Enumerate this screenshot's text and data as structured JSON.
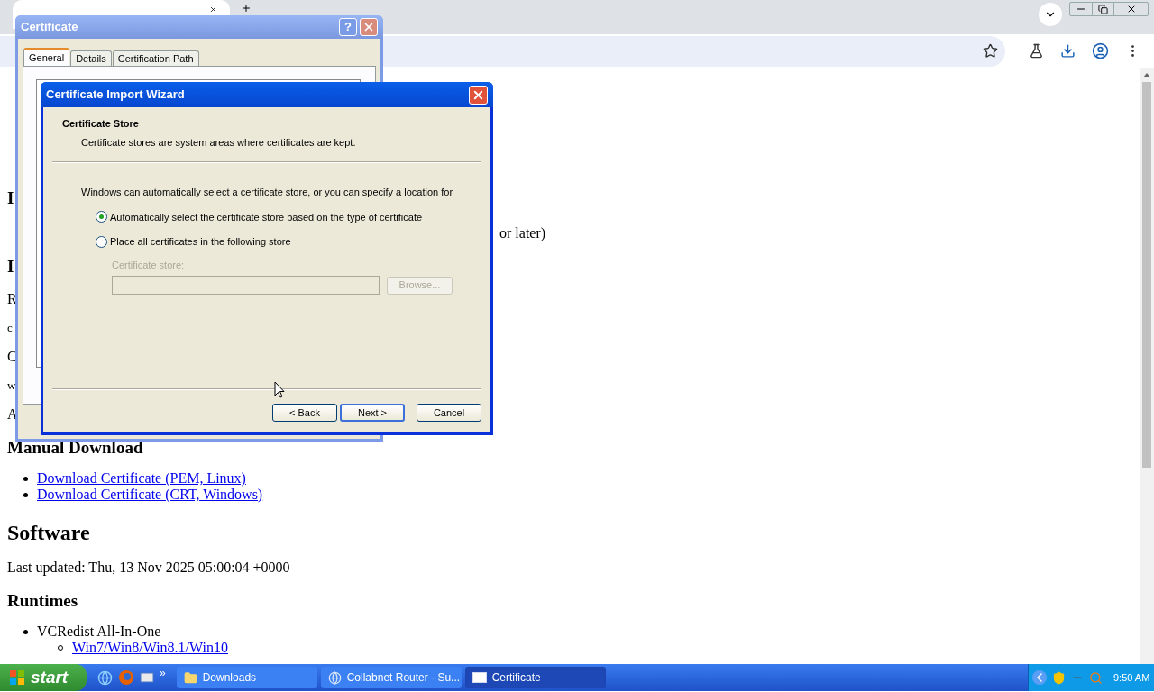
{
  "page": {
    "items": [
      {
        "kind": "h3",
        "text": "I"
      },
      {
        "kind": "tail",
        "text": "or later)"
      },
      {
        "kind": "h3",
        "text": "I"
      },
      {
        "kind": "p",
        "text": "R"
      },
      {
        "kind": "small",
        "text": "c"
      },
      {
        "kind": "p",
        "text": "C"
      },
      {
        "kind": "small",
        "text": "w"
      },
      {
        "kind": "p",
        "text": "A"
      },
      {
        "kind": "h3",
        "text": "Manual Download"
      },
      {
        "kind": "link",
        "text": "Download Certificate (PEM, Linux)"
      },
      {
        "kind": "link",
        "text": "Download Certificate (CRT, Windows)"
      },
      {
        "kind": "h2",
        "text": "Software"
      },
      {
        "kind": "p",
        "text": "Last updated: Thu, 13 Nov 2025 05:00:04 +0000"
      },
      {
        "kind": "h3",
        "text": "Runtimes"
      },
      {
        "kind": "li",
        "text": "VCRedist All-In-One"
      },
      {
        "kind": "sublink",
        "text": "Win7/Win8/Win8.1/Win10"
      }
    ]
  },
  "certificate_dialog": {
    "title": "Certificate",
    "help": "?",
    "tabs": [
      {
        "label": "General",
        "selected": true
      },
      {
        "label": "Details",
        "selected": false
      },
      {
        "label": "Certification Path",
        "selected": false
      }
    ]
  },
  "wizard": {
    "title": "Certificate Import Wizard",
    "heading": "Certificate Store",
    "subtitle": "Certificate stores are system areas where certificates are kept.",
    "intro": "Windows can automatically select a certificate store, or you can specify a location for",
    "options": [
      {
        "label": "Automatically select the certificate store based on the type of certificate",
        "selected": true
      },
      {
        "label": "Place all certificates in the following store",
        "selected": false
      }
    ],
    "store_label": "Certificate store:",
    "browse": "Browse...",
    "store_disabled": true,
    "buttons": [
      {
        "label": "< Back",
        "default": false
      },
      {
        "label": "Next >",
        "default": true
      },
      {
        "label": "Cancel",
        "default": false
      }
    ]
  },
  "taskbar": {
    "start": "start",
    "more": "»",
    "tasks": [
      {
        "label": "Downloads",
        "kind": "folder",
        "selected": false
      },
      {
        "label": "Collabnet Router - Su...",
        "kind": "browser",
        "selected": false
      },
      {
        "label": "Certificate",
        "kind": "window",
        "selected": true
      }
    ],
    "clock": "9:50 AM"
  }
}
